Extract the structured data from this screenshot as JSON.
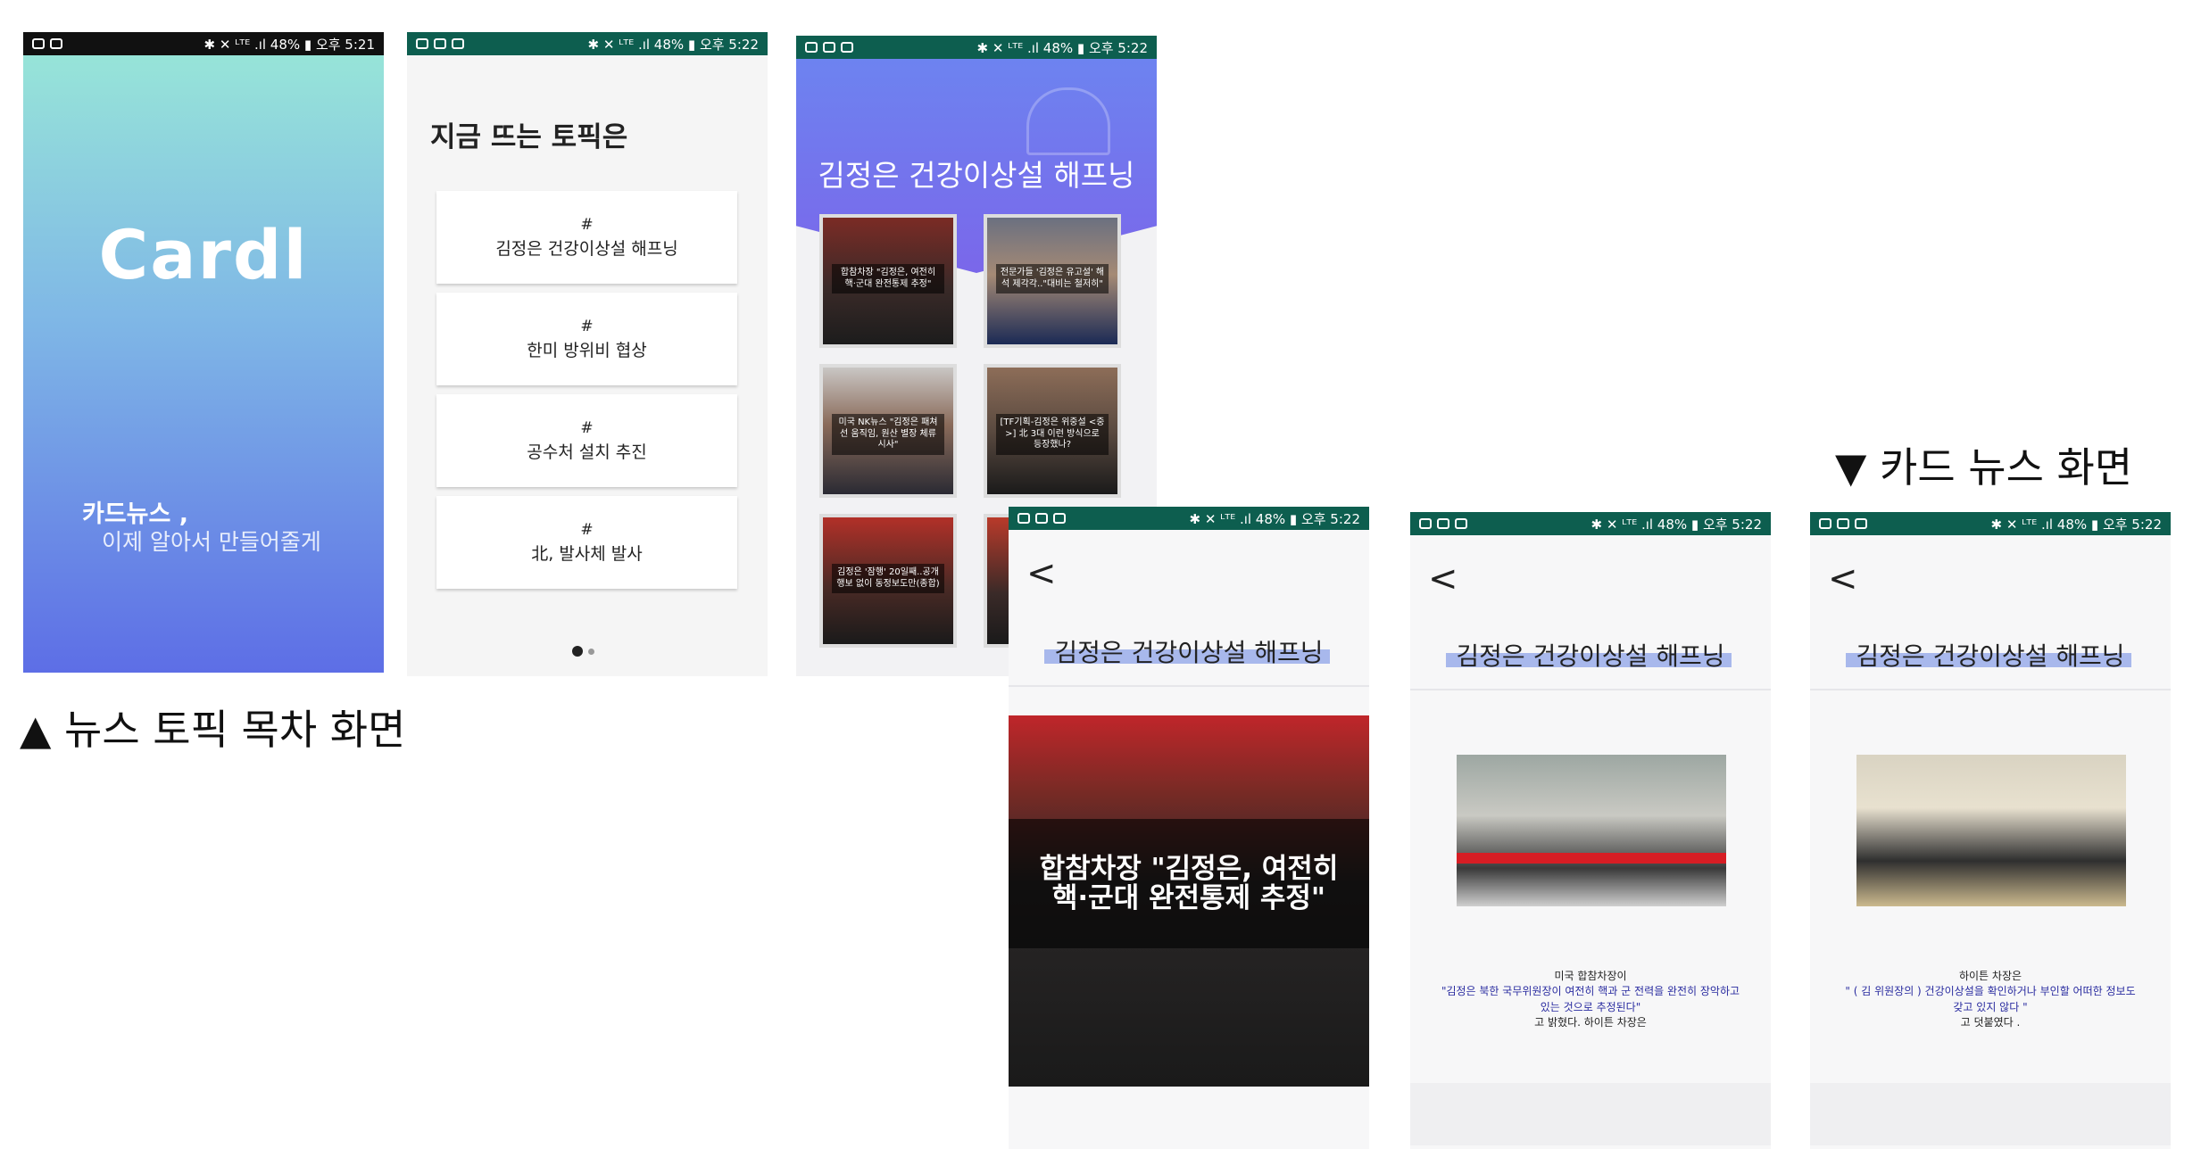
{
  "statusbar": {
    "screen1": {
      "right": "✱ ✕ ᴸᵀᴱ .ıl 48% ▮ 오후 5:21"
    },
    "screen2": {
      "right": "✱ ✕ ᴸᵀᴱ .ıl 48% ▮ 오후 5:22"
    },
    "screen3": {
      "right": "✱ ✕ ᴸᵀᴱ .ıl 48% ▮ 오후 5:22"
    },
    "screen4": {
      "right": "✱ ✕ ᴸᵀᴱ .ıl 48% ▮ 오후 5:22"
    },
    "screen5": {
      "right": "✱ ✕ ᴸᵀᴱ .ıl 48% ▮ 오후 5:22"
    },
    "screen6": {
      "right": "✱ ✕ ᴸᵀᴱ .ıl 48% ▮ 오후 5:22"
    }
  },
  "splash": {
    "logo": "Cardl",
    "tagline1": "카드뉴스 ,",
    "tagline2": "이제 알아서 만들어줄게"
  },
  "topics": {
    "title": "지금 뜨는 토픽은",
    "hash": "#",
    "items": [
      "김정은 건강이상설 해프닝",
      "한미 방위비 협상",
      "공수처 설치 추진",
      "北, 발사체 발사"
    ]
  },
  "grid": {
    "title": "김정은 건강이상설 해프닝",
    "captions": [
      "합참차장 \"김정은, 여전히 핵·군대 완전통제 추정\"",
      "전문가들 '김정은 유고설' 해석 제각각..\"대비는 철저히\"",
      "미국 NK뉴스 \"김정은 패쳐선 움직임, 원산 별장 체류 시사\"",
      "[TF기획-김정은 위중설 <중>] 北 3대 이런 방식으로 등장했나?",
      "김정은 '잠행' 20일째..공개행보 없이 동정보도만(종합)",
      ""
    ]
  },
  "detail": {
    "back": "<",
    "title": "김정은 건강이상설 해프닝",
    "card1_caption_line1": "합참차장 \"김정은, 여전히",
    "card1_caption_line2": "핵·군대 완전통제 추정\"",
    "card2": {
      "line1": "미국 합참차장이",
      "line2": "\"김정은 북한 국무위원장이 여전히 핵과 군 전력을 완전히 장악하고",
      "line3": "있는 것으로 추정된다\"",
      "line4": "고 밝혔다. 하이튼 차장은"
    },
    "card3": {
      "line1": "하이튼 차장은",
      "line2": "\" ( 김 위원장의 ) 건강이상설을 확인하거나 부인할 어떠한 정보도",
      "line3": "갖고 있지 않다 \"",
      "line4": "고 덧붙였다 ."
    }
  },
  "labels": {
    "topic_screen": "▲ 뉴스 토픽 목차 화면",
    "card_screen": "▼ 카드 뉴스 화면"
  },
  "colors": {
    "status_green": "#0d5e4f",
    "accent_blue": "#6d83f0",
    "highlight": "#a8b8ec"
  }
}
